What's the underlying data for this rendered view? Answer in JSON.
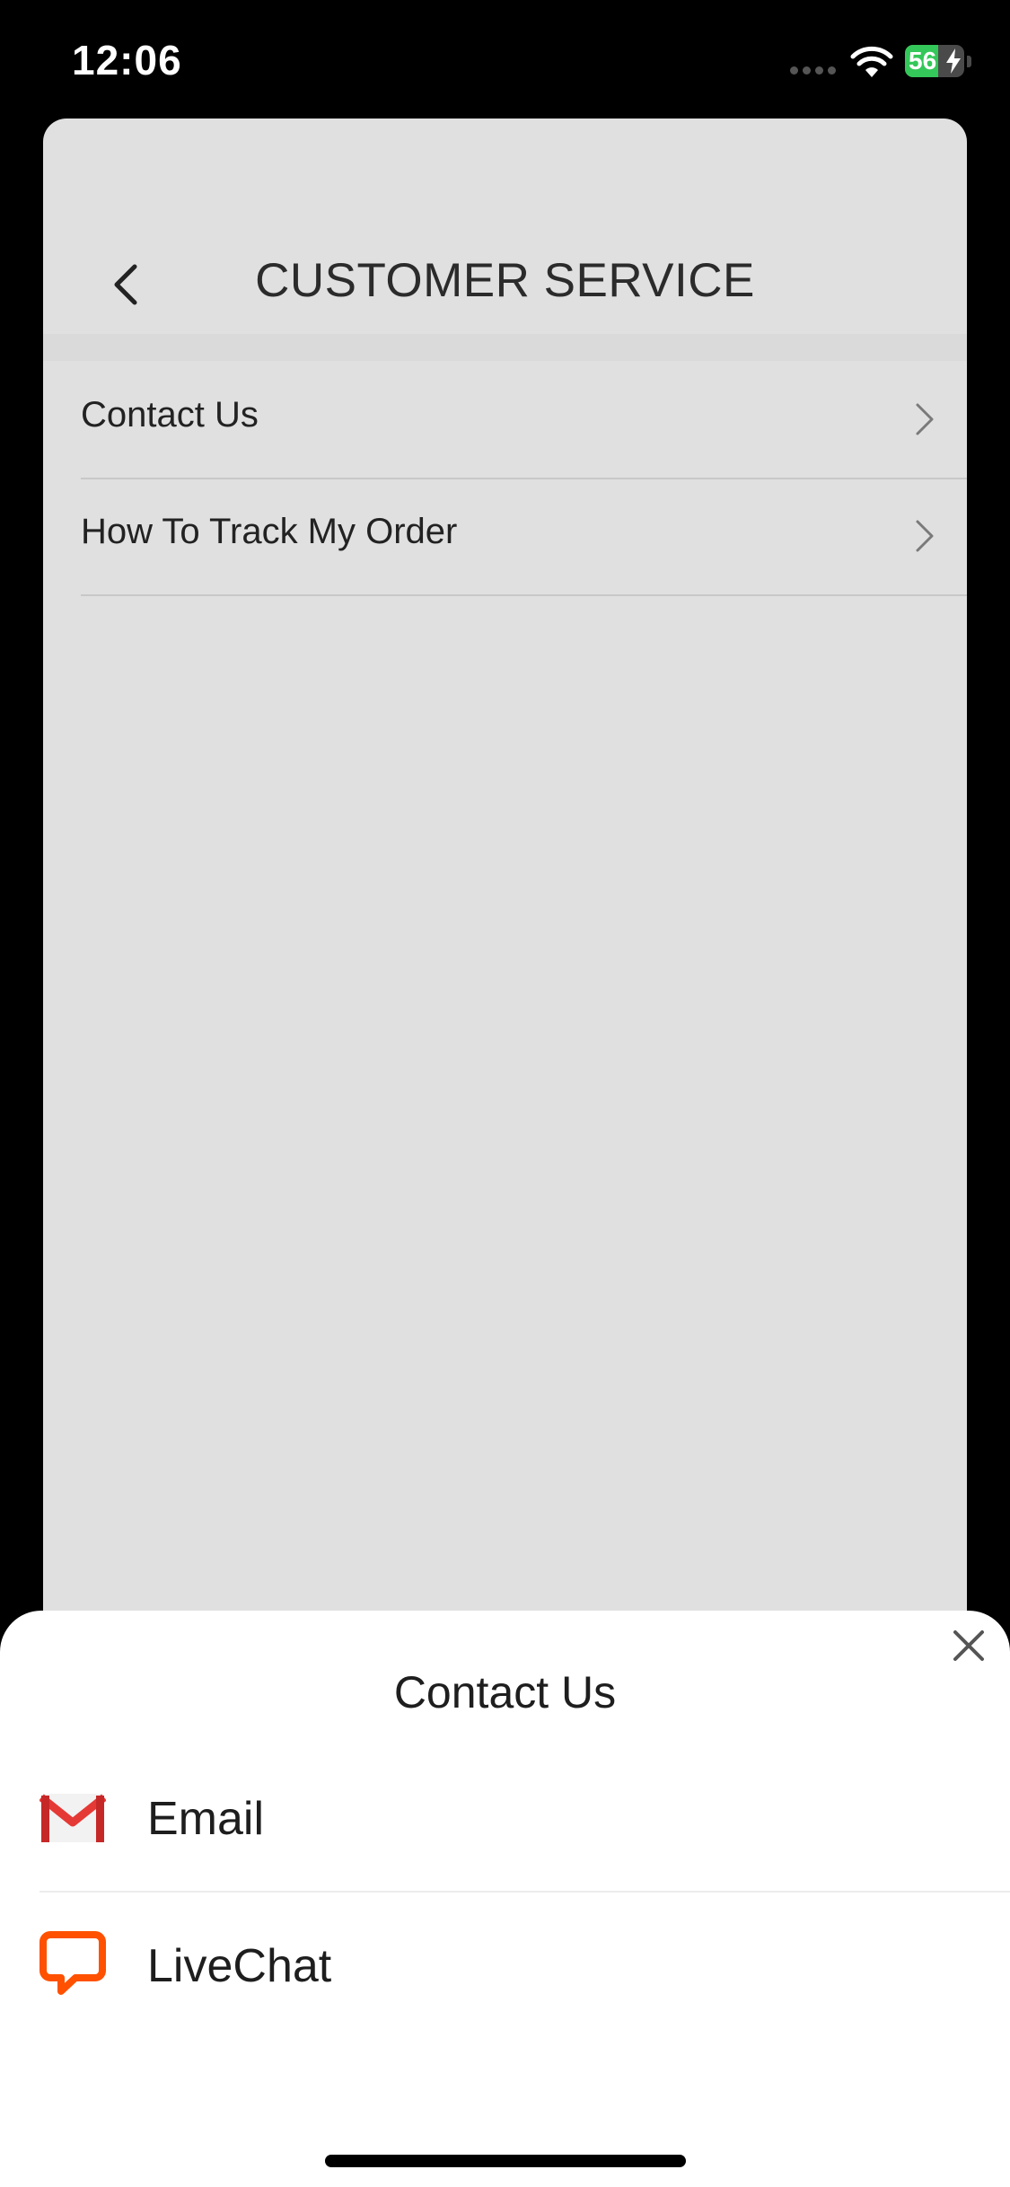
{
  "status_bar": {
    "time": "12:06",
    "battery_level": "56",
    "battery_color": "#34c759"
  },
  "header": {
    "title": "CUSTOMER SERVICE",
    "back_icon": "chevron-left-icon"
  },
  "menu": {
    "items": [
      {
        "label": "Contact Us",
        "icon": "chevron-right-icon"
      },
      {
        "label": "How To Track My Order",
        "icon": "chevron-right-icon"
      }
    ]
  },
  "sheet": {
    "title": "Contact Us",
    "close_icon": "close-icon",
    "options": [
      {
        "label": "Email",
        "icon": "gmail-icon"
      },
      {
        "label": "LiveChat",
        "icon": "livechat-icon",
        "accent": "#ff5100"
      }
    ]
  }
}
